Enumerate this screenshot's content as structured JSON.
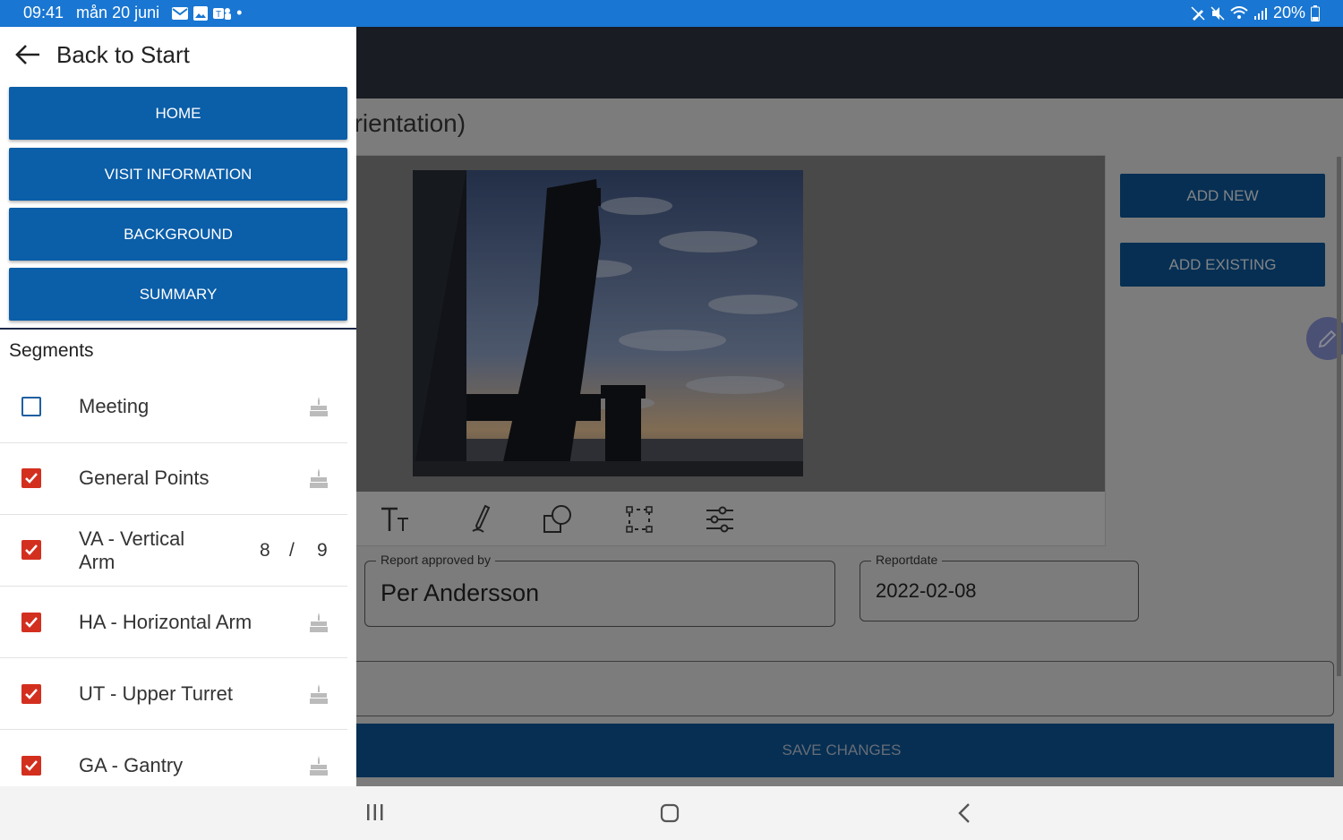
{
  "status_bar": {
    "time": "09:41",
    "date": "mån 20 juni",
    "battery": "20%"
  },
  "drawer": {
    "back_label": "Back to Start",
    "nav_buttons": [
      "HOME",
      "VISIT INFORMATION",
      "BACKGROUND",
      "SUMMARY"
    ],
    "segments_title": "Segments",
    "segments": [
      {
        "label": "Meeting",
        "checked": false,
        "count": "",
        "total": ""
      },
      {
        "label": "General Points",
        "checked": true,
        "count": "",
        "total": ""
      },
      {
        "label": "VA - Vertical Arm",
        "checked": true,
        "count": "8",
        "total": "9"
      },
      {
        "label": "HA - Horizontal Arm",
        "checked": true,
        "count": "",
        "total": ""
      },
      {
        "label": "UT - Upper Turret",
        "checked": true,
        "count": "",
        "total": ""
      },
      {
        "label": "GA - Gantry",
        "checked": true,
        "count": "",
        "total": ""
      }
    ],
    "count_separator": "/"
  },
  "main": {
    "title_fragment": "orientation)",
    "add_new_label": "ADD NEW",
    "add_existing_label": "ADD EXISTING",
    "approved_by": {
      "label": "Report approved by",
      "value": "Per Andersson"
    },
    "reportdate": {
      "label": "Reportdate",
      "value": "2022-02-08"
    },
    "save_label": "SAVE CHANGES"
  },
  "colors": {
    "status_bar": "#1976d2",
    "nav_button": "#0b5ea8",
    "checkbox_checked": "#d32f1f",
    "checkbox_unchecked": "#1f5fa0"
  }
}
